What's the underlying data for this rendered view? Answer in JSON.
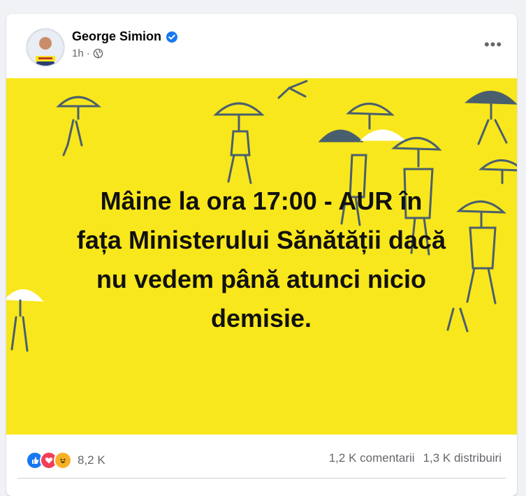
{
  "post": {
    "author": "George Simion",
    "time": "1h",
    "separator": "·",
    "more_label": "•••",
    "image_text": {
      "line1": "Mâine la ora 17:00 - AUR în",
      "line2": "fața Ministerului Sănătății dacă",
      "line3": "nu vedem până atunci nicio",
      "line4": "demisie."
    }
  },
  "reactions": {
    "count": "8,2 K",
    "icons": [
      "like-icon",
      "love-icon",
      "haha-icon"
    ]
  },
  "stats": {
    "comments": "1,2 K comentarii",
    "shares": "1,3 K distribuiri"
  },
  "colors": {
    "image_bg": "#f8e71c",
    "figure": "#4a5f6e",
    "verified": "#1877f2"
  }
}
